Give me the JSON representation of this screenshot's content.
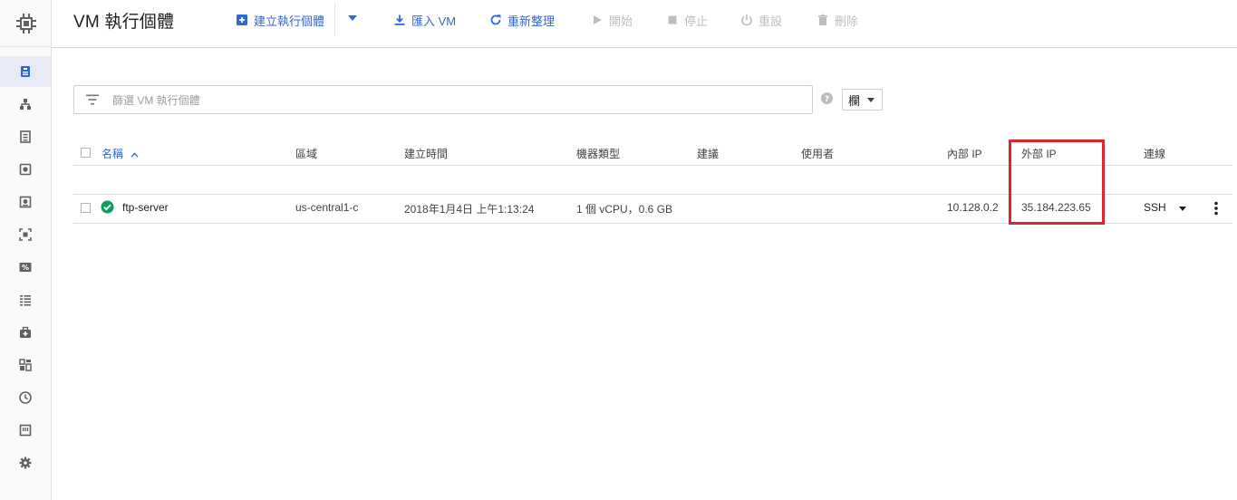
{
  "header": {
    "title": "VM 執行個體",
    "toolbar": {
      "create": "建立執行個體",
      "import": "匯入 VM",
      "refresh": "重新整理",
      "start": "開始",
      "stop": "停止",
      "reset": "重設",
      "delete": "刪除"
    }
  },
  "filter": {
    "placeholder": "篩選 VM 執行個體",
    "columns_label": "欄"
  },
  "table": {
    "headers": {
      "name": "名稱",
      "zone": "區域",
      "created": "建立時間",
      "machine_type": "機器類型",
      "recommendation": "建議",
      "in_use_by": "使用者",
      "internal_ip": "內部 IP",
      "external_ip": "外部 IP",
      "connect": "連線"
    },
    "rows": [
      {
        "name": "ftp-server",
        "zone": "us-central1-c",
        "created": "2018年1月4日 上午1:13:24",
        "machine_type": "1 個 vCPU，0.6 GB",
        "internal_ip": "10.128.0.2",
        "external_ip": "35.184.223.65",
        "connect": "SSH"
      }
    ]
  },
  "colors": {
    "accent": "#3367d6",
    "status_ok": "#0f9d58",
    "highlight": "#e0242e"
  }
}
